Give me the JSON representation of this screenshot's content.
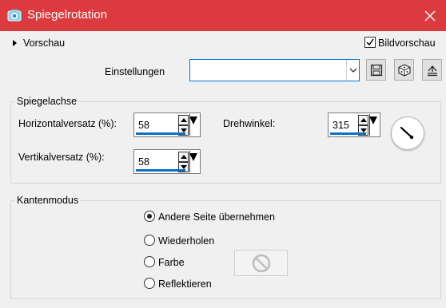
{
  "window": {
    "title": "Spiegelrotation",
    "close_icon": "close-icon",
    "app_icon": "camera-icon"
  },
  "preview": {
    "label": "Vorschau",
    "bildvorschau_label": "Bildvorschau",
    "bildvorschau_checked": true
  },
  "settings": {
    "label": "Einstellungen",
    "value": "",
    "buttons": [
      "save-preset-icon",
      "randomize-dice-icon",
      "reset-icon"
    ]
  },
  "mirror_axis": {
    "title": "Spiegelachse",
    "horizontal_label": "Horizontalversatz (%):",
    "horizontal_value": "58",
    "vertical_label": "Vertikalversatz (%):",
    "vertical_value": "58",
    "rotation_label": "Drehwinkel:",
    "rotation_value": "315"
  },
  "edge_mode": {
    "title": "Kantenmodus",
    "options": [
      "Andere Seite übernehmen",
      "Wiederholen",
      "Farbe",
      "Reflektieren"
    ],
    "selected": "Andere Seite übernehmen"
  },
  "colors": {
    "titlebar": "#db3a3f",
    "accent": "#0b6fc4"
  }
}
